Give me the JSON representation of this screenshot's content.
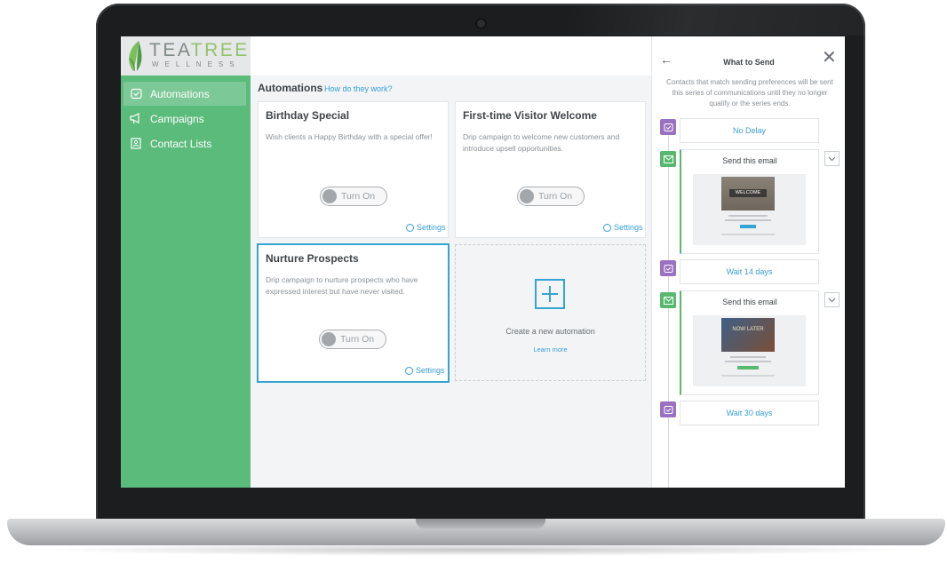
{
  "brand": {
    "name_part1": "TEA",
    "name_part2": "TREE",
    "tagline": "WELLNESS"
  },
  "sidebar": {
    "items": [
      {
        "label": "Automations",
        "icon": "clock-icon",
        "active": true
      },
      {
        "label": "Campaigns",
        "icon": "megaphone-icon",
        "active": false
      },
      {
        "label": "Contact Lists",
        "icon": "contact-book-icon",
        "active": false
      }
    ]
  },
  "main": {
    "title": "Automations",
    "help_link": "How do they work?",
    "cards": [
      {
        "title": "Birthday Special",
        "description": "Wish clients a Happy Birthday with a special offer!",
        "toggle": "Turn On",
        "settings": "Settings"
      },
      {
        "title": "First-time Visitor Welcome",
        "description": "Drip campaign to welcome new customers and introduce upsell opportunities.",
        "toggle": "Turn On",
        "settings": "Settings"
      },
      {
        "title": "Nurture Prospects",
        "description": "Drip campaign to nurture prospects who have expressed interest but have never visited.",
        "toggle": "Turn On",
        "settings": "Settings"
      }
    ],
    "new_automation": {
      "label": "Create a new automation",
      "link": "Learn more"
    }
  },
  "panel": {
    "title": "What to Send",
    "description": "Contacts that match sending preferences will be sent this series of communications until they no longer qualify or the series ends.",
    "steps": [
      {
        "type": "wait",
        "label": "No Delay"
      },
      {
        "type": "email",
        "label": "Send this email",
        "thumbnail_text": "WELCOME"
      },
      {
        "type": "wait",
        "label": "Wait 14 days"
      },
      {
        "type": "email",
        "label": "Send this email",
        "thumbnail_text": "NOW LATER"
      },
      {
        "type": "wait",
        "label": "Wait 30 days"
      }
    ]
  },
  "colors": {
    "sidebar": "#5bbb7b",
    "sidebar_active": "#7cc897",
    "accent_blue": "#36a4d1",
    "timeline_purple": "#9b72c1",
    "timeline_green": "#58b96e"
  }
}
